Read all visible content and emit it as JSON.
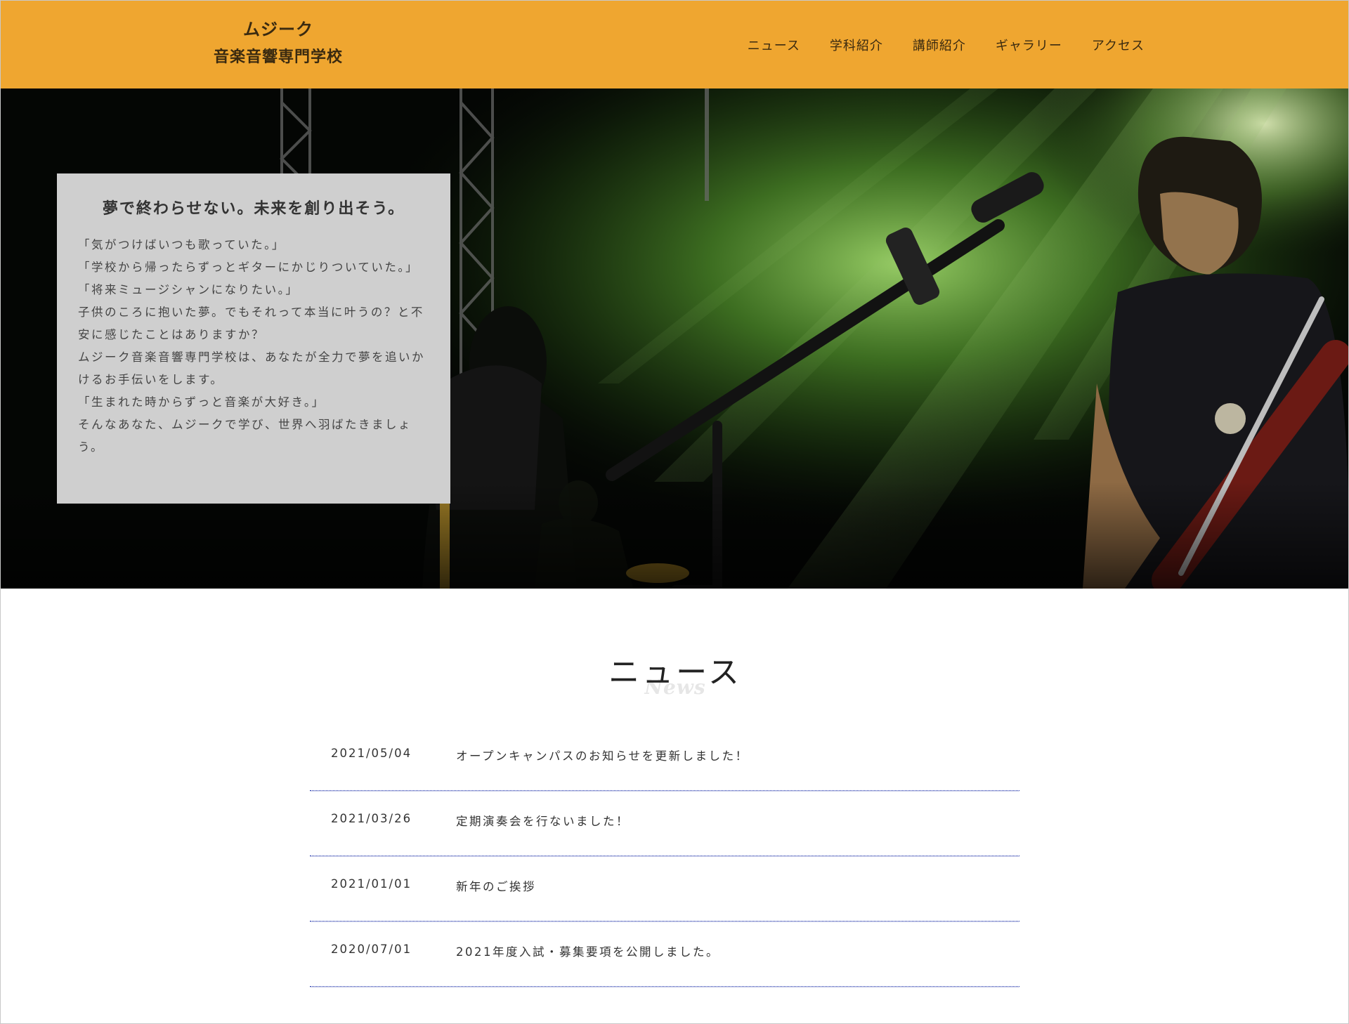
{
  "header": {
    "logo_line1": "ムジーク",
    "logo_line2": "音楽音響専門学校",
    "brand_color": "#efa630",
    "nav": [
      "ニュース",
      "学科紹介",
      "講師紹介",
      "ギャラリー",
      "アクセス"
    ]
  },
  "hero": {
    "title": "夢で終わらせない。未来を創り出そう。",
    "text": "「気がつけばいつも歌っていた。」\n「学校から帰ったらずっとギターにかじりついていた。」\n「将来ミュージシャンになりたい。」\n子供のころに抱いた夢。でもそれって本当に叶うの？と不安に感じたことはありますか？\nムジーク音楽音響専門学校は、あなたが全力で夢を追いかけるお手伝いをします。\n「生まれた時からずっと音楽が大好き。」\nそんなあなた、ムジークで学び、世界へ羽ばたきましょう。",
    "image_icon": "concert-stage-photo"
  },
  "news": {
    "heading": "ニュース",
    "subheading": "News",
    "items": [
      {
        "date": "2021/05/04",
        "title": "オープンキャンパスのお知らせを更新しました！"
      },
      {
        "date": "2021/03/26",
        "title": "定期演奏会を行ないました！"
      },
      {
        "date": "2021/01/01",
        "title": "新年のご挨拶"
      },
      {
        "date": "2020/07/01",
        "title": "2021年度入試・募集要項を公開しました。"
      }
    ]
  }
}
